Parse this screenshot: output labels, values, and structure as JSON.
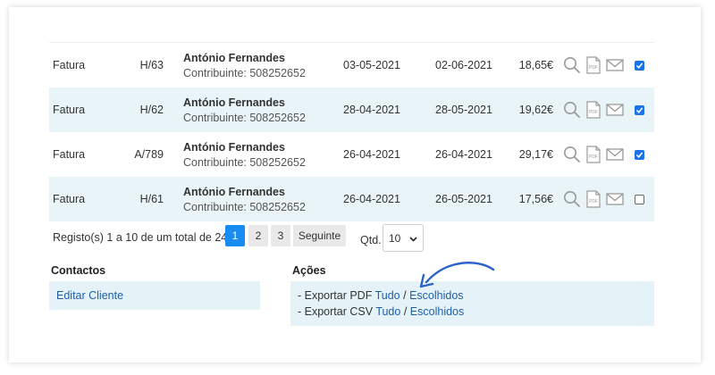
{
  "rows": [
    {
      "type": "Fatura",
      "number": "H/63",
      "client_name": "António Fernandes",
      "client_nif": "Contribuinte: 508252652",
      "date_issue": "03-05-2021",
      "date_due": "02-06-2021",
      "amount": "18,65€",
      "checked": true
    },
    {
      "type": "Fatura",
      "number": "H/62",
      "client_name": "António Fernandes",
      "client_nif": "Contribuinte: 508252652",
      "date_issue": "28-04-2021",
      "date_due": "28-05-2021",
      "amount": "19,62€",
      "checked": true
    },
    {
      "type": "Fatura",
      "number": "A/789",
      "client_name": "António Fernandes",
      "client_nif": "Contribuinte: 508252652",
      "date_issue": "26-04-2021",
      "date_due": "26-04-2021",
      "amount": "29,17€",
      "checked": true
    },
    {
      "type": "Fatura",
      "number": "H/61",
      "client_name": "António Fernandes",
      "client_nif": "Contribuinte: 508252652",
      "date_issue": "26-04-2021",
      "date_due": "26-05-2021",
      "amount": "17,56€",
      "checked": false
    }
  ],
  "row_icons": [
    "search-icon",
    "pdf-icon",
    "mail-icon"
  ],
  "pdf_label": "PDF",
  "pagination": {
    "summary": "Registo(s) 1 a 10 de um total de 24",
    "pages": [
      "1",
      "2",
      "3"
    ],
    "active_page": "1",
    "next_label": "Seguinte",
    "qty_label": "Qtd.",
    "qty_value": "10"
  },
  "contacts": {
    "title": "Contactos",
    "edit_label": "Editar Cliente"
  },
  "actions": {
    "title": "Ações",
    "pdf_prefix": "- Exportar PDF",
    "csv_prefix": "- Exportar CSV",
    "all_label": "Tudo",
    "separator": "/",
    "chosen_label": "Escolhidos"
  },
  "colors": {
    "accent": "#1a8bf0",
    "checkbox": "#1a73e8",
    "row_alt": "#e8f4f7",
    "panel": "#e5f3f8",
    "link": "#1f5fa8",
    "icon": "#9a9a9a",
    "annotation_arrow": "#2a62c9"
  }
}
